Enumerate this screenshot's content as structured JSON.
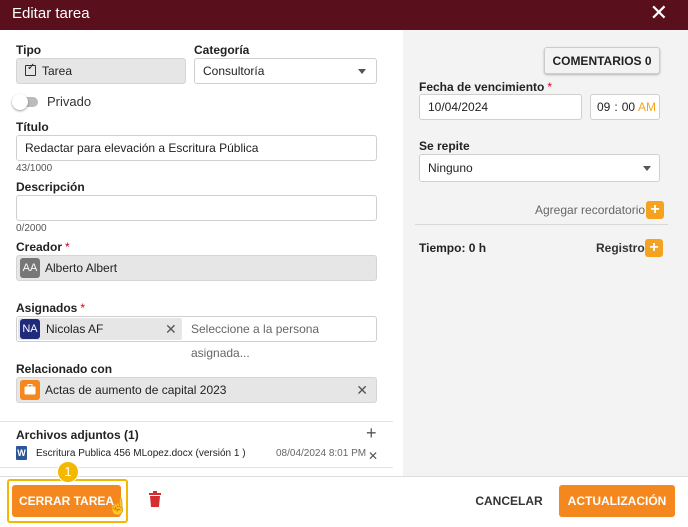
{
  "dialog": {
    "title": "Editar tarea"
  },
  "left": {
    "tipo_label": "Tipo",
    "tipo_value": "Tarea",
    "categoria_label": "Categoría",
    "categoria_value": "Consultoría",
    "privado_label": "Privado",
    "privado_on": false,
    "titulo_label": "Título",
    "titulo_value": "Redactar para elevación a Escritura Pública",
    "titulo_counter": "43/1000",
    "descripcion_label": "Descripción",
    "descripcion_value": "",
    "descripcion_counter": "0/2000",
    "creador_label": "Creador",
    "creador_initials": "AA",
    "creador_name": "Alberto Albert",
    "asignados_label": "Asignados",
    "asignado_initials": "NA",
    "asignado_name": "Nicolas AF",
    "asignados_placeholder": "Seleccione a la persona asignada...",
    "relacionado_label": "Relacionado con",
    "relacionado_value": "Actas de aumento de capital 2023",
    "archivos_label": "Archivos adjuntos (1)",
    "archivo_name": "Escritura Publica 456 MLopez.docx (versión 1 )",
    "archivo_date": "08/04/2024 8:01 PM",
    "required_mark": "*"
  },
  "right": {
    "comentarios_button": "COMENTARIOS 0",
    "fecha_label": "Fecha de vencimiento",
    "fecha_value": "10/04/2024",
    "hora": "09",
    "minuto": "00",
    "ampm": "AM",
    "repite_label": "Se repite",
    "repite_value": "Ninguno",
    "recordatorio_label": "Agregar recordatorio",
    "tiempo_label": "Tiempo: 0 h",
    "registro_label": "Registro"
  },
  "footer": {
    "cerrar_button": "CERRAR TAREA",
    "step_badge": "1",
    "cancelar_button": "CANCELAR",
    "actualizacion_button": "ACTUALIZACIÓN"
  },
  "colors": {
    "titlebar": "#5a0f1c",
    "accent_orange": "#f5871f",
    "highlight_yellow": "#f5b800",
    "creador_avatar": "#777777",
    "asignado_avatar": "#1f2a7a"
  }
}
